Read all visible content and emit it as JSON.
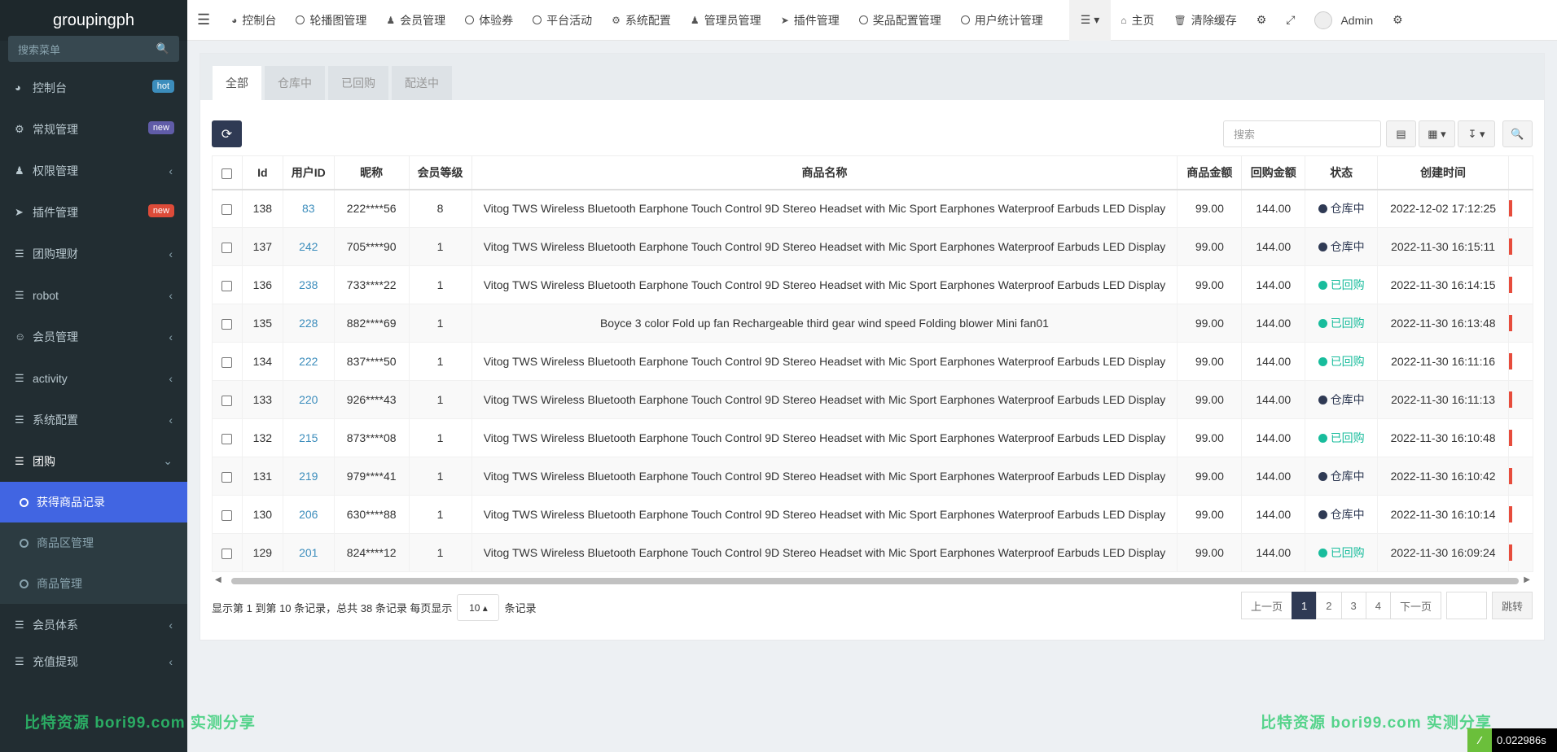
{
  "app_title": "groupingph",
  "sidebar": {
    "search_placeholder": "搜索菜单",
    "items": [
      {
        "label": "控制台",
        "badge": "hot",
        "badge_color": "#3c8dbc"
      },
      {
        "label": "常规管理",
        "badge": "new",
        "badge_color": "#605ca8"
      },
      {
        "label": "权限管理"
      },
      {
        "label": "插件管理",
        "badge": "new",
        "badge_color": "#dd4b39"
      },
      {
        "label": "团购理财"
      },
      {
        "label": "robot"
      },
      {
        "label": "会员管理"
      },
      {
        "label": "activity"
      },
      {
        "label": "系统配置"
      },
      {
        "label": "团购"
      }
    ],
    "sub_items": [
      {
        "label": "获得商品记录"
      },
      {
        "label": "商品区管理"
      },
      {
        "label": "商品管理"
      }
    ],
    "items_after": [
      {
        "label": "会员体系"
      },
      {
        "label": "充值提现"
      }
    ]
  },
  "topnav": {
    "items": [
      "控制台",
      "轮播图管理",
      "会员管理",
      "体验券",
      "平台活动",
      "系统配置",
      "管理员管理",
      "插件管理",
      "奖品配置管理",
      "用户统计管理"
    ],
    "home": "主页",
    "clear_cache": "清除缓存",
    "user": "Admin"
  },
  "tabs": [
    "全部",
    "仓库中",
    "已回购",
    "配送中"
  ],
  "toolbar": {
    "search_placeholder": "搜索"
  },
  "table": {
    "headers": [
      "Id",
      "用户ID",
      "昵称",
      "会员等级",
      "商品名称",
      "商品金额",
      "回购金额",
      "状态",
      "创建时间"
    ],
    "rows": [
      {
        "id": "138",
        "uid": "83",
        "nick": "222****56",
        "level": "8",
        "name": "Vitog TWS Wireless Bluetooth Earphone Touch Control 9D Stereo Headset with Mic Sport Earphones Waterproof Earbuds LED Display",
        "price": "99.00",
        "buyback": "144.00",
        "status": "仓库中",
        "status_type": "stock",
        "time": "2022-12-02 17:12:25"
      },
      {
        "id": "137",
        "uid": "242",
        "nick": "705****90",
        "level": "1",
        "name": "Vitog TWS Wireless Bluetooth Earphone Touch Control 9D Stereo Headset with Mic Sport Earphones Waterproof Earbuds LED Display",
        "price": "99.00",
        "buyback": "144.00",
        "status": "仓库中",
        "status_type": "stock",
        "time": "2022-11-30 16:15:11"
      },
      {
        "id": "136",
        "uid": "238",
        "nick": "733****22",
        "level": "1",
        "name": "Vitog TWS Wireless Bluetooth Earphone Touch Control 9D Stereo Headset with Mic Sport Earphones Waterproof Earbuds LED Display",
        "price": "99.00",
        "buyback": "144.00",
        "status": "已回购",
        "status_type": "bought",
        "time": "2022-11-30 16:14:15"
      },
      {
        "id": "135",
        "uid": "228",
        "nick": "882****69",
        "level": "1",
        "name": "Boyce 3 color Fold up fan Rechargeable third gear wind speed Folding blower Mini fan01",
        "price": "99.00",
        "buyback": "144.00",
        "status": "已回购",
        "status_type": "bought",
        "time": "2022-11-30 16:13:48"
      },
      {
        "id": "134",
        "uid": "222",
        "nick": "837****50",
        "level": "1",
        "name": "Vitog TWS Wireless Bluetooth Earphone Touch Control 9D Stereo Headset with Mic Sport Earphones Waterproof Earbuds LED Display",
        "price": "99.00",
        "buyback": "144.00",
        "status": "已回购",
        "status_type": "bought",
        "time": "2022-11-30 16:11:16"
      },
      {
        "id": "133",
        "uid": "220",
        "nick": "926****43",
        "level": "1",
        "name": "Vitog TWS Wireless Bluetooth Earphone Touch Control 9D Stereo Headset with Mic Sport Earphones Waterproof Earbuds LED Display",
        "price": "99.00",
        "buyback": "144.00",
        "status": "仓库中",
        "status_type": "stock",
        "time": "2022-11-30 16:11:13"
      },
      {
        "id": "132",
        "uid": "215",
        "nick": "873****08",
        "level": "1",
        "name": "Vitog TWS Wireless Bluetooth Earphone Touch Control 9D Stereo Headset with Mic Sport Earphones Waterproof Earbuds LED Display",
        "price": "99.00",
        "buyback": "144.00",
        "status": "已回购",
        "status_type": "bought",
        "time": "2022-11-30 16:10:48"
      },
      {
        "id": "131",
        "uid": "219",
        "nick": "979****41",
        "level": "1",
        "name": "Vitog TWS Wireless Bluetooth Earphone Touch Control 9D Stereo Headset with Mic Sport Earphones Waterproof Earbuds LED Display",
        "price": "99.00",
        "buyback": "144.00",
        "status": "仓库中",
        "status_type": "stock",
        "time": "2022-11-30 16:10:42"
      },
      {
        "id": "130",
        "uid": "206",
        "nick": "630****88",
        "level": "1",
        "name": "Vitog TWS Wireless Bluetooth Earphone Touch Control 9D Stereo Headset with Mic Sport Earphones Waterproof Earbuds LED Display",
        "price": "99.00",
        "buyback": "144.00",
        "status": "仓库中",
        "status_type": "stock",
        "time": "2022-11-30 16:10:14"
      },
      {
        "id": "129",
        "uid": "201",
        "nick": "824****12",
        "level": "1",
        "name": "Vitog TWS Wireless Bluetooth Earphone Touch Control 9D Stereo Headset with Mic Sport Earphones Waterproof Earbuds LED Display",
        "price": "99.00",
        "buyback": "144.00",
        "status": "已回购",
        "status_type": "bought",
        "time": "2022-11-30 16:09:24"
      }
    ]
  },
  "status_colors": {
    "stock": "#2f3a54",
    "bought": "#18bc9c"
  },
  "pagination": {
    "info_prefix": "显示第 1 到第 10 条记录，总共 38 条记录 每页显示",
    "page_size": "10",
    "info_suffix": "条记录",
    "prev": "上一页",
    "pages": [
      "1",
      "2",
      "3",
      "4"
    ],
    "next": "下一页",
    "jump": "跳转"
  },
  "watermark": "比特资源  bori99.com  实测分享",
  "timer": "0.022986s"
}
